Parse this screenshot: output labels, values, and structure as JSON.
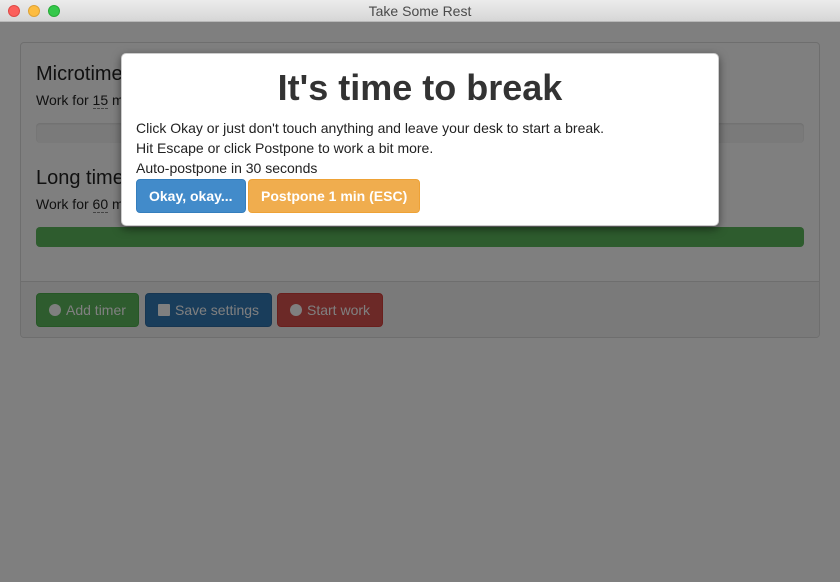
{
  "window": {
    "title": "Take Some Rest"
  },
  "timers": [
    {
      "name": "Microtimer",
      "desc_prefix": "Work for",
      "minutes": "15",
      "desc_suffix": "minutes",
      "progress": 0.0
    },
    {
      "name": "Long timer",
      "desc_prefix": "Work for",
      "minutes": "60",
      "desc_suffix": "minutes",
      "progress": 1.0
    }
  ],
  "footer": {
    "add_timer": "Add timer",
    "save_settings": "Save settings",
    "start_work": "Start work"
  },
  "modal": {
    "heading": "It's time to break",
    "line1": "Click Okay or just don't touch anything and leave your desk to start a break.",
    "line2": "Hit Escape or click Postpone to work a bit more.",
    "autopostpone_prefix": "Auto-postpone in",
    "autopostpone_seconds": "30",
    "autopostpone_suffix": "seconds",
    "okay_button": "Okay, okay...",
    "postpone_button": "Postpone 1 min (ESC)"
  },
  "colors": {
    "progress_fill": "#5cb85c",
    "okay": "#428bca",
    "postpone": "#f0ad4e"
  }
}
